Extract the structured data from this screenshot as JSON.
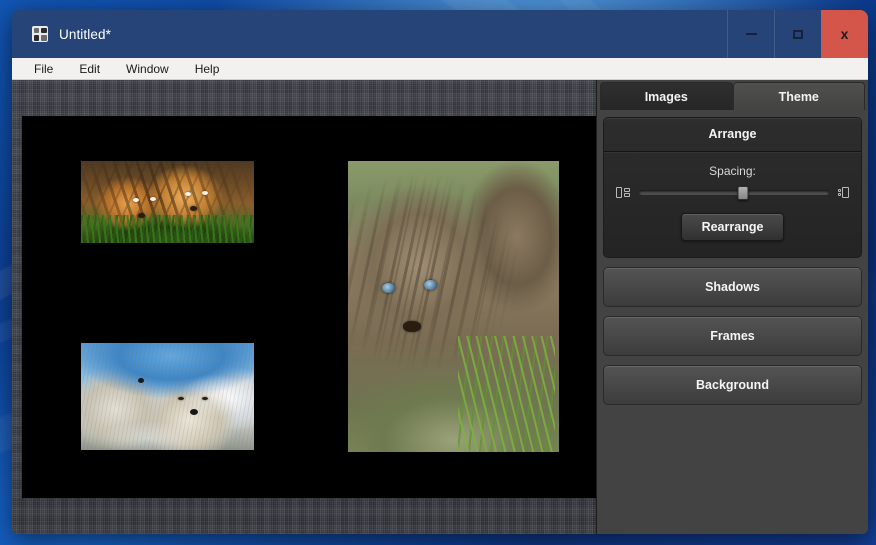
{
  "window": {
    "title": "Untitled*",
    "icon": "collage-app-icon",
    "controls": {
      "minimize": "–",
      "maximize": "□",
      "close": "x"
    }
  },
  "menubar": {
    "items": [
      {
        "label": "File"
      },
      {
        "label": "Edit"
      },
      {
        "label": "Window"
      },
      {
        "label": "Help"
      }
    ]
  },
  "canvas": {
    "sheet_background_color": "#000000",
    "photos": [
      {
        "name": "tiger-cubs",
        "alt": "Two tiger cubs lying in green grass"
      },
      {
        "name": "arctic-wolves",
        "alt": "Two arctic wolves in snow under blue sky"
      },
      {
        "name": "cougar-cubs",
        "alt": "Two cougar cubs with blue eyes in grass"
      }
    ]
  },
  "side_panel": {
    "tabs": [
      {
        "label": "Images",
        "active": true
      },
      {
        "label": "Theme",
        "active": false
      }
    ],
    "arrange": {
      "title": "Arrange",
      "spacing_label": "Spacing:",
      "spacing_value": 55,
      "spacing_min_icon": "spacing-tight-icon",
      "spacing_max_icon": "spacing-wide-icon",
      "rearrange_label": "Rearrange"
    },
    "sections": [
      {
        "label": "Shadows"
      },
      {
        "label": "Frames"
      },
      {
        "label": "Background"
      }
    ]
  },
  "colors": {
    "titlebar": "#264477",
    "close_button": "#d4564a",
    "panel_background": "#434343",
    "card_background": "#2b2b2b",
    "menubar": "#f2f1f0"
  }
}
